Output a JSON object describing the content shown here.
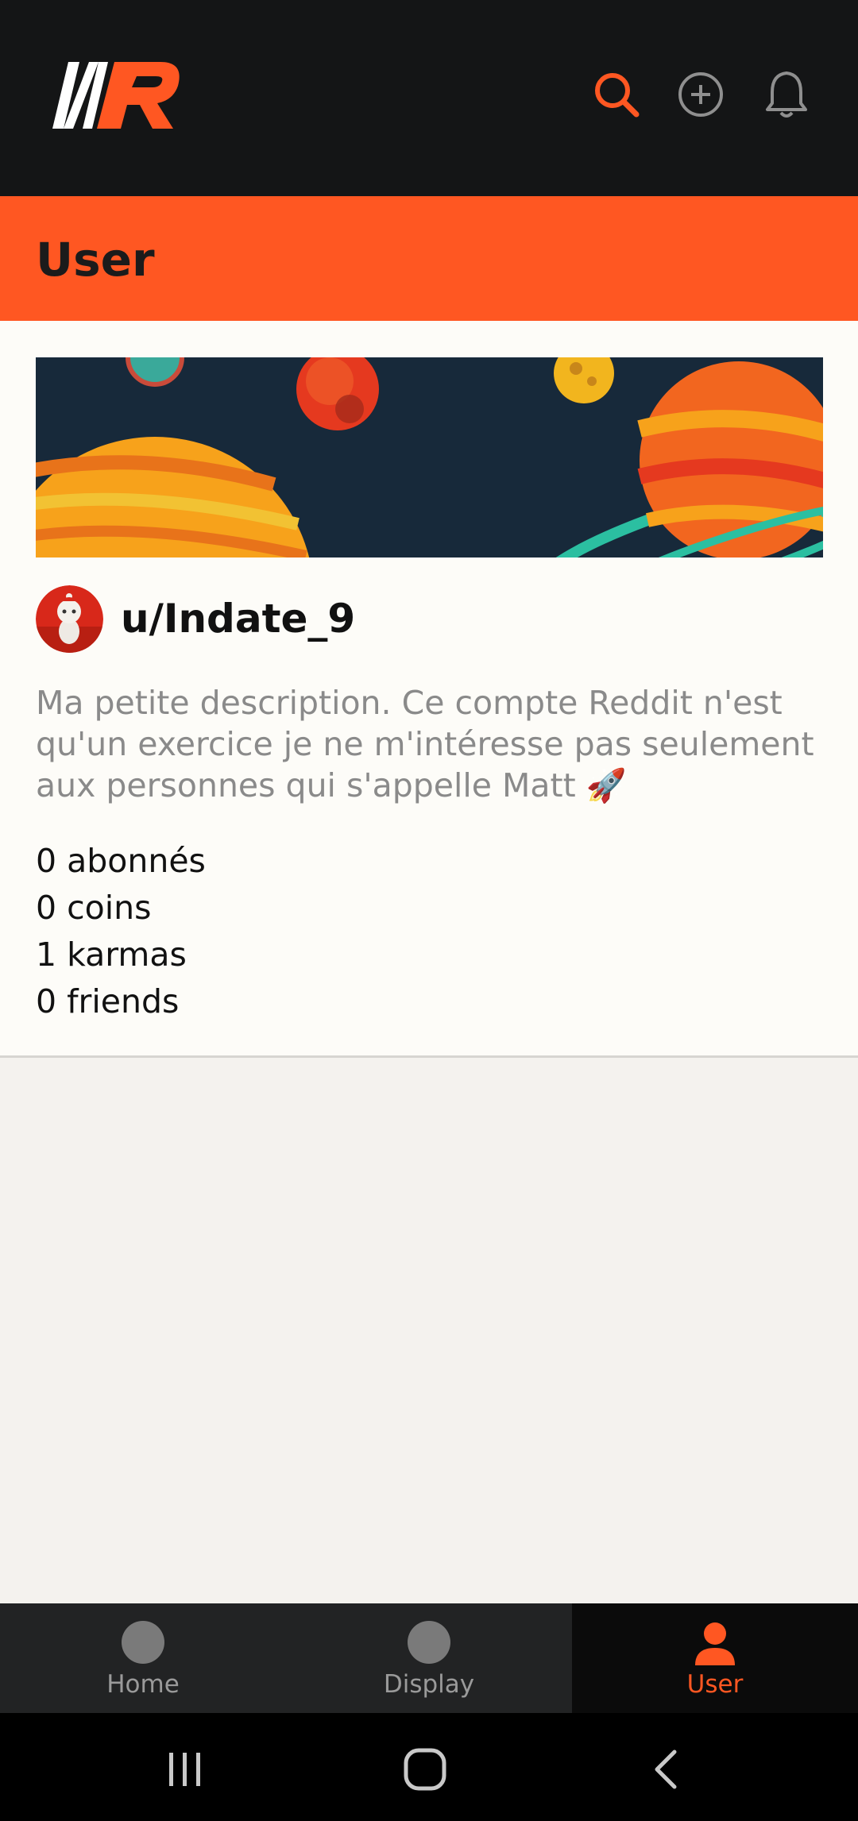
{
  "topbar": {
    "logo_text": "NR",
    "icons": [
      "search-icon",
      "add-circle-icon",
      "bell-icon"
    ]
  },
  "section": {
    "title": "User"
  },
  "profile": {
    "username": "u/Indate_9",
    "description": "Ma petite description. Ce compte Reddit n'est qu'un exercice je ne m'intéresse pas seulement aux personnes qui s'appelle Matt 🚀",
    "stats": {
      "subscribers": "0 abonnés",
      "coins": "0 coins",
      "karma": "1 karmas",
      "friends": "0 friends"
    }
  },
  "bottom_nav": {
    "items": [
      {
        "label": "Home"
      },
      {
        "label": "Display"
      },
      {
        "label": "User"
      }
    ],
    "active": "User"
  },
  "colors": {
    "accent": "#ff5722",
    "topbar": "#141516",
    "banner_bg": "#17293a"
  }
}
